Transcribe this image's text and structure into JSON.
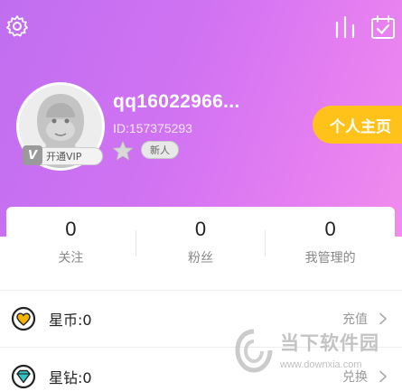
{
  "header": {
    "background_gradient": [
      "#c06ef0",
      "#f08cee"
    ],
    "settings_icon": "gear-icon",
    "stats_icon": "bar-chart-icon",
    "checkin_icon": "calendar-check-icon"
  },
  "profile": {
    "username": "qq16022966...",
    "user_id": "ID:157375293",
    "vip_badge_label": "开通VIP",
    "vip_letter": "V",
    "level_icon": "star-icon",
    "level_tag": "新人",
    "homepage_button": "个人主页",
    "homepage_button_color": "#ffc21a"
  },
  "stats": [
    {
      "value": "0",
      "label": "关注"
    },
    {
      "value": "0",
      "label": "粉丝"
    },
    {
      "value": "0",
      "label": "我管理的"
    }
  ],
  "wallet": [
    {
      "label": "星币:0",
      "action": "充值",
      "icon": "heart-coin-icon",
      "icon_color": "#f5b400"
    },
    {
      "label": "星钻:0",
      "action": "兑换",
      "icon": "diamond-icon",
      "icon_color": "#2ec6c6"
    }
  ],
  "watermark": {
    "title": "当下软件园",
    "url": "www.downxia.com"
  }
}
